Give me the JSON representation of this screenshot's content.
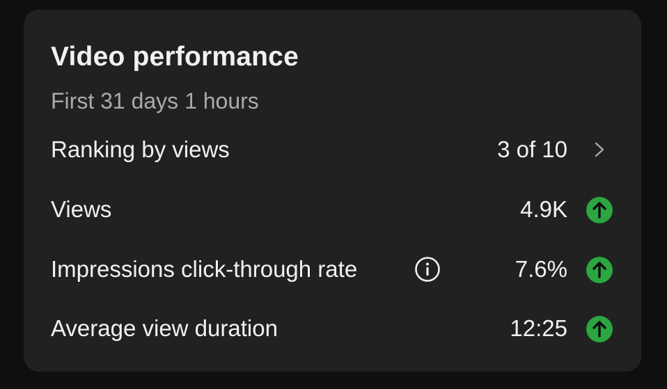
{
  "card": {
    "title": "Video performance",
    "subtitle": "First 31 days 1 hours"
  },
  "rows": [
    {
      "label": "Ranking by views",
      "value": "3 of 10",
      "indicator": "chevron-right-icon"
    },
    {
      "label": "Views",
      "value": "4.9K",
      "indicator": "arrow-up-circle-icon"
    },
    {
      "label": "Impressions click-through rate",
      "value": "7.6%",
      "indicator": "arrow-up-circle-icon",
      "has_info": true
    },
    {
      "label": "Average view duration",
      "value": "12:25",
      "indicator": "arrow-up-circle-icon"
    }
  ],
  "colors": {
    "background": "#0f0f0f",
    "card": "#212121",
    "text_primary": "#f1f1f1",
    "text_secondary": "#aaaaaa",
    "trend_up": "#2ba640"
  }
}
